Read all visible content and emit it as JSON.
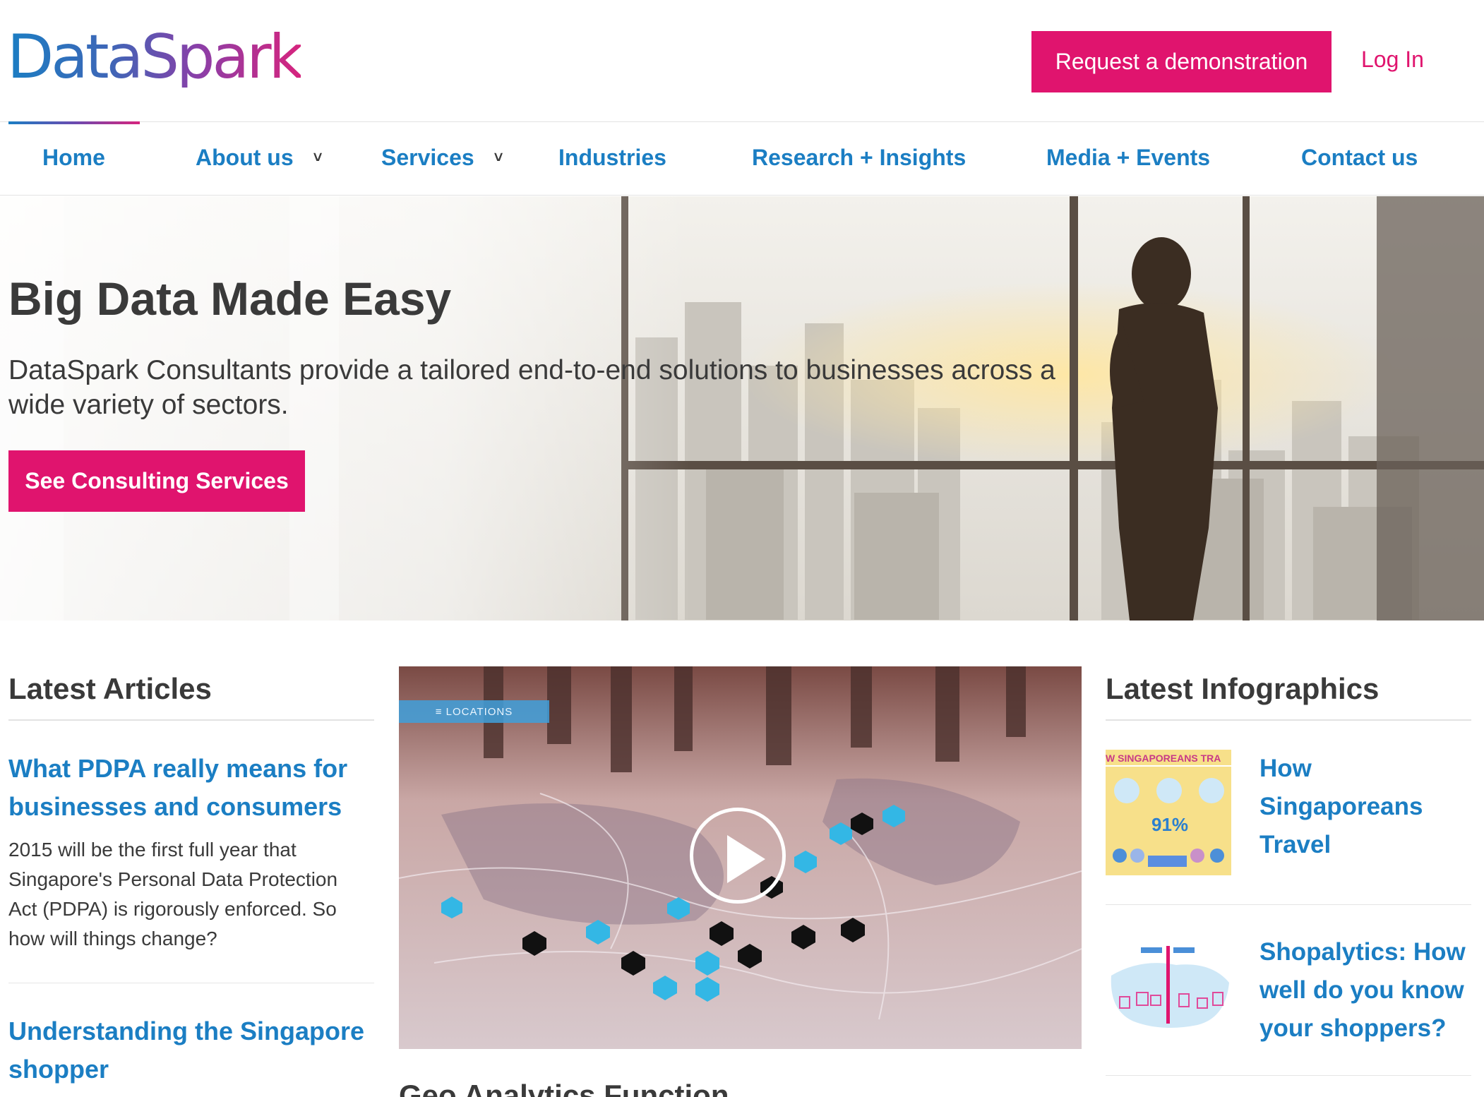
{
  "header": {
    "logo": "DataSpark",
    "demo_button": "Request a demonstration",
    "login": "Log In"
  },
  "nav": {
    "items": [
      {
        "label": "Home",
        "has_dropdown": false
      },
      {
        "label": "About us",
        "has_dropdown": true
      },
      {
        "label": "Services",
        "has_dropdown": true
      },
      {
        "label": "Industries",
        "has_dropdown": false
      },
      {
        "label": "Research + Insights",
        "has_dropdown": false
      },
      {
        "label": "Media + Events",
        "has_dropdown": false
      },
      {
        "label": "Contact us",
        "has_dropdown": false
      }
    ]
  },
  "hero": {
    "title": "Big Data Made Easy",
    "text": "DataSpark Consultants provide a tailored end-to-end solutions to businesses across a wide variety of sectors.",
    "button": "See Consulting Services"
  },
  "articles": {
    "heading": "Latest Articles",
    "items": [
      {
        "title": "What PDPA really means for businesses and consumers",
        "body": "2015 will be the first full year that Singapore's Personal Data Protection Act (PDPA) is rigorously enforced. So how will things change?"
      },
      {
        "title": "Understanding the Singapore shopper",
        "body": ""
      }
    ]
  },
  "video": {
    "overlay_tag": "≡ LOCATIONS",
    "next_heading": "Geo Analytics Function"
  },
  "infographics": {
    "heading": "Latest Infographics",
    "items": [
      {
        "title": "How Singaporeans Travel",
        "thumb_banner": "W SINGAPOREANS TRA",
        "thumb_stat": "91%"
      },
      {
        "title": "Shopalytics: How well do you know your shoppers?",
        "thumb_banner": "",
        "thumb_stat": ""
      }
    ]
  },
  "colors": {
    "brand_pink": "#e0146e",
    "link_blue": "#1b7ec3",
    "text_dark": "#3a3a3a"
  },
  "icons": {
    "dropdown": "chevron-down-icon",
    "play": "play-icon"
  }
}
